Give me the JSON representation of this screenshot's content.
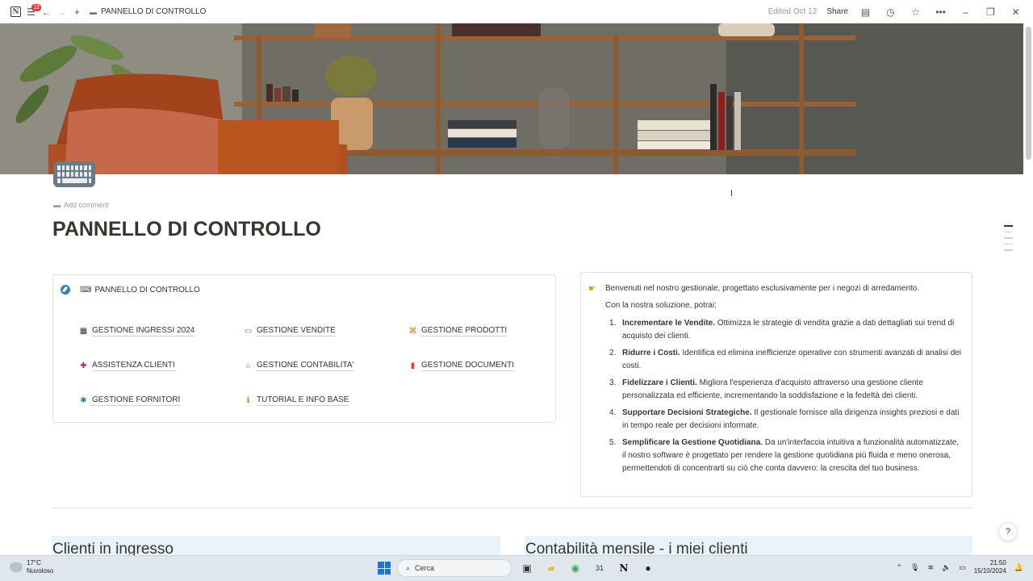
{
  "topbar": {
    "notification_count": "12",
    "page_name": "PANNELLO DI CONTROLLO",
    "edited": "Edited Oct 12",
    "share_label": "Share"
  },
  "page": {
    "add_comment": "Add comment",
    "title": "PANNELLO DI CONTROLLO"
  },
  "nav_card": {
    "title": "PANNELLO DI CONTROLLO",
    "items": [
      {
        "label": "GESTIONE INGRESSI 2024",
        "icon": "calendar-icon",
        "color": "#37352f",
        "glyph": "▦"
      },
      {
        "label": "GESTIONE VENDITE",
        "icon": "money-icon",
        "color": "#2f9a5e",
        "glyph": "▭"
      },
      {
        "label": "GESTIONE PRODOTTI",
        "icon": "command-icon",
        "color": "#d9730d",
        "glyph": "⌘"
      },
      {
        "label": "ASSISTENZA CLIENTI",
        "icon": "lifebuoy-icon",
        "color": "#ad1a72",
        "glyph": "✚"
      },
      {
        "label": "GESTIONE CONTABILITA'",
        "icon": "bank-icon",
        "color": "#787774",
        "glyph": "⌂"
      },
      {
        "label": "GESTIONE DOCUMENTI",
        "icon": "document-icon",
        "color": "#e03e3e",
        "glyph": "▮"
      },
      {
        "label": "GESTIONE FORNITORI",
        "icon": "asterisk-icon",
        "color": "#337ea9",
        "glyph": "✱"
      },
      {
        "label": "TUTORIAL E INFO BASE",
        "icon": "info-icon",
        "color": "#d9730d",
        "glyph": "ℹ"
      }
    ]
  },
  "callout": {
    "intro": "Benvenuti nel nostro gestionale, progettato esclusivamente per i negozi di arredamento.",
    "sub": "Con la nostra soluzione, potrai:",
    "points": [
      {
        "num": "1.",
        "bold": "Incrementare le Vendite.",
        "text": " Ottimizza le strategie di vendita grazie a dati dettagliati sui trend di acquisto dei clienti."
      },
      {
        "num": "2.",
        "bold": "Ridurre i Costi.",
        "text": " Identifica ed elimina inefficienze operative con strumenti avanzati di analisi dei costi."
      },
      {
        "num": "3.",
        "bold": "Fidelizzare i Clienti.",
        "text": " Migliora l'esperienza d'acquisto attraverso una gestione cliente personalizzata ed efficiente, incrementando la soddisfazione e la fedeltà dei clienti."
      },
      {
        "num": "4.",
        "bold": "Supportare Decisioni Strategiche.",
        "text": " Il gestionale fornisce alla dirigenza insights preziosi e dati in tempo reale per decisioni informate."
      },
      {
        "num": "5.",
        "bold": "Semplificare la Gestione Quotidiana.",
        "text": " Da un'interfaccia intuitiva a funzionalità automatizzate, il nostro software è progettato per rendere la gestione quotidiana più fluida e meno onerosa, permettendoti di concentrarti su ciò che conta davvero: la crescita del tuo business."
      }
    ]
  },
  "sections": {
    "left_title": "Clienti in ingresso",
    "right_title": "Contabilità mensile - i miei clienti"
  },
  "help": "?",
  "taskbar": {
    "temp": "17°C",
    "weather": "Nuvoloso",
    "search": "Cerca",
    "time": "21:50",
    "date": "15/10/2024"
  }
}
